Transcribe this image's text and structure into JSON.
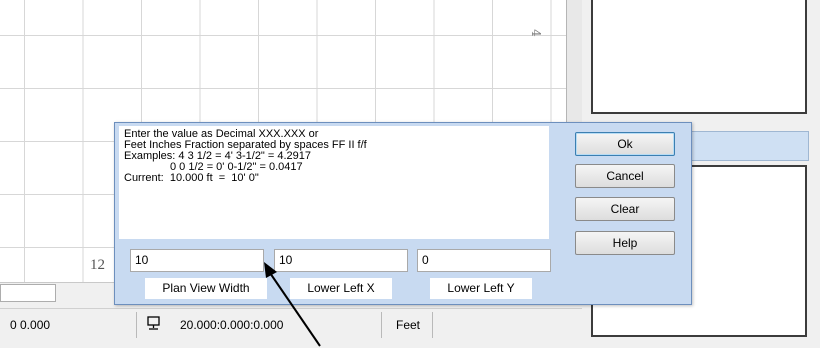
{
  "grid": {
    "top_label": "4",
    "left_label": "12"
  },
  "status_bar": {
    "coords": "0  0.000",
    "xyz": "20.000:0.000:0.000",
    "units": "Feet"
  },
  "dialog": {
    "instructions": {
      "line1": "Enter the value as Decimal XXX.XXX or",
      "line2": "Feet Inches Fraction separated by spaces FF II f/f",
      "line3": "Examples: 4 3 1/2 = 4' 3-1/2\" = 4.2917",
      "line4": "0 0 1/2 = 0' 0-1/2\" = 0.0417",
      "line5": "Current:  10.000 ft  =  10' 0\""
    },
    "buttons": {
      "ok": "Ok",
      "cancel": "Cancel",
      "clear": "Clear",
      "help": "Help"
    },
    "fields": [
      {
        "value": "10",
        "label": "Plan View Width"
      },
      {
        "value": "10",
        "label": "Lower Left X"
      },
      {
        "value": "0",
        "label": "Lower Left Y"
      }
    ]
  },
  "colors": {
    "dialog_frame": "#c8daf1",
    "dialog_border": "#6d8fbd",
    "panel_header": "#cfe0f3"
  }
}
